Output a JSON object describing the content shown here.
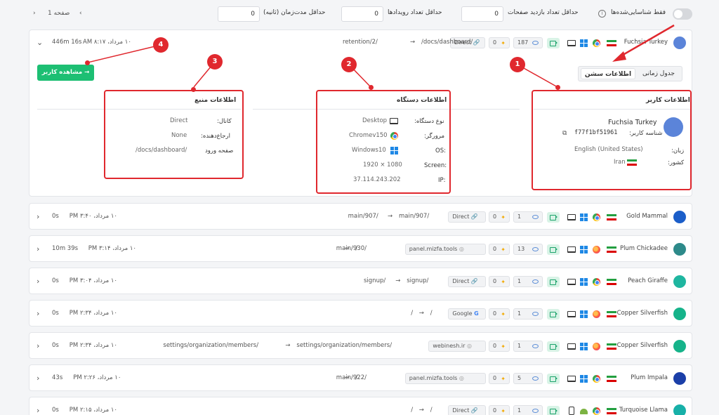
{
  "filters": {
    "identified_only": "فقط شناسایی‌شده‌ها",
    "min_page_visits_label": "حداقل تعداد بازدید صفحات",
    "min_page_visits_value": "0",
    "min_events_label": "حداقل تعداد رویدادها",
    "min_events_value": "0",
    "min_duration_label": "حداقل مدت‌زمان (ثانیه)",
    "min_duration_value": "0"
  },
  "pager": {
    "label": "صفحه 1",
    "prev": "‹",
    "next": "›"
  },
  "expanded": {
    "name": "Fuchsia Turkey",
    "time": "۱۰ مرداد، AM ۸:۱۷",
    "duration": "446m 16s",
    "path_from": "/docs/dashboard/",
    "path_to": "retention/2/",
    "channel": "Direct",
    "clicks": "0",
    "views": "187",
    "tabs": {
      "timeline": "جدول زمانی",
      "session_info": "اطلاعات سشن"
    },
    "view_user_button": "مشاهده کاربر",
    "user_info": {
      "title": "اطلاعات کاربر",
      "name": "Fuchsia Turkey",
      "user_id_label": "شناسه کاربر:",
      "user_id": "f77f1bf51961",
      "language_label": "زبان:",
      "language": "English (United States)",
      "country_label": "کشور:",
      "country": "Iran"
    },
    "device_info": {
      "title": "اطلاعات دستگاه",
      "device_type_label": "نوع دستگاه:",
      "device_type": "Desktop",
      "browser_label": "مرورگر:",
      "browser": "Chromev150",
      "os_label": "OS:",
      "os": "Windows10",
      "screen_label": "Screen:",
      "screen": "1920 × 1080",
      "ip_label": "IP:",
      "ip": "37.114.243.202"
    },
    "source_info": {
      "title": "اطلاعات منبع",
      "channel_label": "کانال:",
      "channel": "Direct",
      "referrer_label": "ارجاع‌دهنده:",
      "referrer": "None",
      "entry_label": "صفحه ورود",
      "entry": "/docs/dashboard/"
    },
    "annotations": [
      "1",
      "2",
      "3",
      "4"
    ]
  },
  "sessions": [
    {
      "name": "Gold Mammal",
      "time": "۱۰ مرداد، PM ۳:۴۰",
      "duration": "0s",
      "path_from": "main/907/",
      "path_to": "main/907/",
      "source": "Direct",
      "source_icon": "link-icon",
      "clicks": "0",
      "views": "1",
      "browser": "chrome",
      "device": "laptop",
      "avatar_color": "#1b5ec9"
    },
    {
      "name": "Plum Chickadee",
      "time": "۱۰ مرداد، PM ۳:۱۴",
      "duration": "10m 39s",
      "path_from": "/",
      "path_to": "main/930/",
      "source": "panel.mizfa.tools",
      "source_icon": "site-icon",
      "clicks": "0",
      "views": "13",
      "browser": "firefox",
      "device": "laptop",
      "avatar_color": "#2d8a8a"
    },
    {
      "name": "Peach Giraffe",
      "time": "۱۰ مرداد، PM ۳:۰۴",
      "duration": "0s",
      "path_from": "signup/",
      "path_to": "signup/",
      "source": "Direct",
      "source_icon": "link-icon",
      "clicks": "0",
      "views": "1",
      "browser": "chrome",
      "device": "laptop",
      "avatar_color": "#1fb6a0"
    },
    {
      "name": "Copper Silverfish",
      "time": "۱۰ مرداد، PM ۲:۳۴",
      "duration": "0s",
      "path_from": "/",
      "path_to": "/",
      "source": "Google",
      "source_icon": "google-icon",
      "clicks": "0",
      "views": "1",
      "browser": "firefox",
      "device": "laptop",
      "avatar_color": "#16b38a"
    },
    {
      "name": "Copper Silverfish",
      "time": "۱۰ مرداد، PM ۲:۳۴",
      "duration": "0s",
      "path_from": "settings/organization/members/",
      "path_to": "settings/organization/members/",
      "source": "webinesh.ir",
      "source_icon": "site-icon",
      "clicks": "0",
      "views": "1",
      "browser": "firefox",
      "device": "laptop",
      "avatar_color": "#16b38a"
    },
    {
      "name": "Plum Impala",
      "time": "۱۰ مرداد، PM ۲:۲۶",
      "duration": "43s",
      "path_from": "/",
      "path_to": "main/922/",
      "source": "panel.mizfa.tools",
      "source_icon": "site-icon",
      "clicks": "0",
      "views": "5",
      "browser": "chrome",
      "device": "laptop",
      "avatar_color": "#1b3fa8"
    },
    {
      "name": "Turquoise Llama",
      "time": "۱۰ مرداد، PM ۲:۱۵",
      "duration": "0s",
      "path_from": "/",
      "path_to": "/",
      "source": "Direct",
      "source_icon": "link-icon",
      "clicks": "0",
      "views": "1",
      "browser": "chrome",
      "device": "phone",
      "avatar_color": "#17b0a8"
    }
  ]
}
